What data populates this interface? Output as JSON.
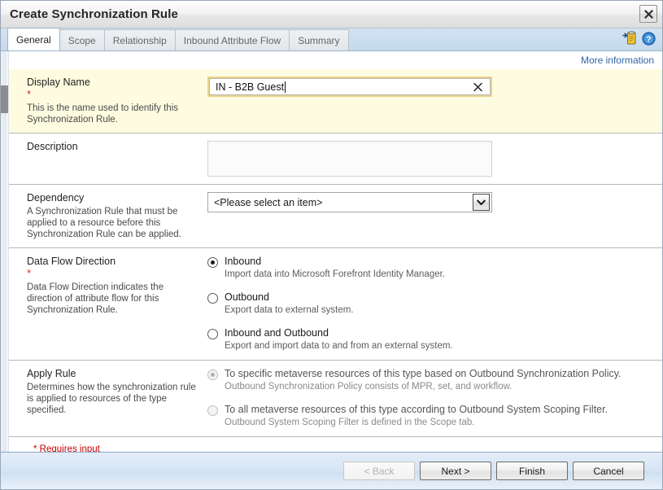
{
  "window": {
    "title": "Create Synchronization Rule",
    "close_icon": "close-icon"
  },
  "tabs": [
    {
      "label": "General",
      "active": true
    },
    {
      "label": "Scope",
      "active": false
    },
    {
      "label": "Relationship",
      "active": false
    },
    {
      "label": "Inbound Attribute Flow",
      "active": false
    },
    {
      "label": "Summary",
      "active": false
    }
  ],
  "tab_icons": [
    {
      "name": "add-to-clipboard-icon"
    },
    {
      "name": "help-icon"
    }
  ],
  "more_information": {
    "label": "More information"
  },
  "sections": {
    "display_name": {
      "title": "Display Name",
      "required_marker": "*",
      "help": "This is the name used to identify this Synchronization Rule.",
      "value": "IN - B2B Guest",
      "clear_icon": "clear-icon"
    },
    "description": {
      "title": "Description",
      "value": "",
      "placeholder": ""
    },
    "dependency": {
      "title": "Dependency",
      "help": "A Synchronization Rule that must be applied to a resource before this Synchronization Rule can be applied.",
      "selected": "<Please select an item>",
      "dropdown_icon": "chevron-down-icon"
    },
    "data_flow_direction": {
      "title": "Data Flow Direction",
      "required_marker": "*",
      "help": "Data Flow Direction indicates the direction of attribute flow for this Synchronization Rule.",
      "options": [
        {
          "label": "Inbound",
          "desc": "Import data into Microsoft Forefront Identity Manager.",
          "checked": true,
          "disabled": false
        },
        {
          "label": "Outbound",
          "desc": "Export data to external system.",
          "checked": false,
          "disabled": false
        },
        {
          "label": "Inbound and Outbound",
          "desc": "Export and import data to and from an external system.",
          "checked": false,
          "disabled": false
        }
      ]
    },
    "apply_rule": {
      "title": "Apply Rule",
      "help": "Determines how the synchronization rule is applied to resources of the type specified.",
      "options": [
        {
          "label": "To specific metaverse resources of this type based on Outbound Synchronization Policy.",
          "desc": "Outbound Synchronization Policy consists of MPR, set, and workflow.",
          "checked": true,
          "disabled": true
        },
        {
          "label": "To all metaverse resources of this type according to Outbound System Scoping Filter.",
          "desc": "Outbound System Scoping Filter is defined in the Scope tab.",
          "checked": false,
          "disabled": true
        }
      ]
    }
  },
  "requires_input_note": "* Requires input",
  "footer_buttons": [
    {
      "label": "< Back",
      "disabled": true
    },
    {
      "label": "Next >",
      "disabled": false
    },
    {
      "label": "Finish",
      "disabled": false
    },
    {
      "label": "Cancel",
      "disabled": false
    }
  ],
  "colors": {
    "highlight_background": "#fdfbe0",
    "required_red": "#d42c2c",
    "link_blue": "#3465a4",
    "tabstrip_blue": "#c5daee",
    "footer_blue": "#d8e6f5"
  }
}
